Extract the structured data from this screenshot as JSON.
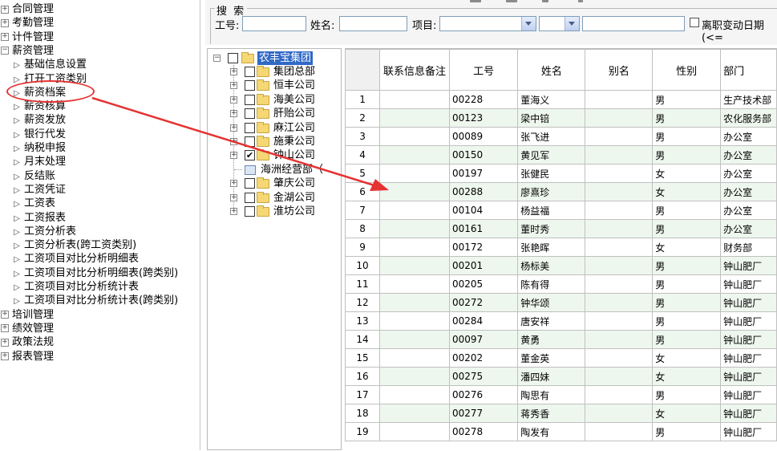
{
  "left_nav": {
    "items": [
      {
        "label": "合同管理",
        "icon": "plus-icon"
      },
      {
        "label": "考勤管理",
        "icon": "plus-icon"
      },
      {
        "label": "计件管理",
        "icon": "plus-icon"
      },
      {
        "label": "薪资管理",
        "icon": "minus-icon"
      },
      {
        "label": "基础信息设置",
        "icon": "expand-arrow-icon"
      },
      {
        "label": "打开工资类别",
        "icon": "triangle-right-icon"
      },
      {
        "label": "薪资档案",
        "icon": "triangle-right-icon"
      },
      {
        "label": "薪资核算",
        "icon": "expand-arrow-icon"
      },
      {
        "label": "薪资发放",
        "icon": "expand-arrow-icon"
      },
      {
        "label": "银行代发",
        "icon": "triangle-right-icon"
      },
      {
        "label": "纳税申报",
        "icon": "expand-arrow-icon"
      },
      {
        "label": "月末处理",
        "icon": "triangle-right-icon"
      },
      {
        "label": "反结账",
        "icon": "triangle-right-icon"
      },
      {
        "label": "工资凭证",
        "icon": "expand-arrow-icon"
      },
      {
        "label": "工资表",
        "icon": "triangle-right-icon"
      },
      {
        "label": "工资报表",
        "icon": "triangle-right-icon"
      },
      {
        "label": "工资分析表",
        "icon": "triangle-right-icon"
      },
      {
        "label": "工资分析表(跨工资类别)",
        "icon": "triangle-right-icon"
      },
      {
        "label": "工资项目对比分析明细表",
        "icon": "triangle-right-icon"
      },
      {
        "label": "工资项目对比分析明细表(跨类别)",
        "icon": "triangle-right-icon"
      },
      {
        "label": "工资项目对比分析统计表",
        "icon": "triangle-right-icon"
      },
      {
        "label": "工资项目对比分析统计表(跨类别)",
        "icon": "triangle-right-icon"
      },
      {
        "label": "培训管理",
        "icon": "plus-icon"
      },
      {
        "label": "绩效管理",
        "icon": "plus-icon"
      },
      {
        "label": "政策法规",
        "icon": "plus-icon"
      },
      {
        "label": "报表管理",
        "icon": "plus-icon"
      }
    ]
  },
  "search": {
    "title": "搜 索",
    "id_label": "工号:",
    "name_label": "姓名:",
    "item_label": "项目:",
    "resign_label": "离职变动日期(<=",
    "id_value": "",
    "name_value": "",
    "item_value": "",
    "op_value": "",
    "keyword_value": ""
  },
  "tree": {
    "root": "农丰宝集团",
    "nodes": [
      {
        "label": "集团总部",
        "checked": false,
        "type": "folder"
      },
      {
        "label": "恒丰公司",
        "checked": false,
        "type": "folder"
      },
      {
        "label": "海美公司",
        "checked": false,
        "type": "folder"
      },
      {
        "label": "肝贻公司",
        "checked": false,
        "type": "folder"
      },
      {
        "label": "麻江公司",
        "checked": false,
        "type": "folder"
      },
      {
        "label": "施秉公司",
        "checked": false,
        "type": "folder"
      },
      {
        "label": "钟山公司",
        "checked": true,
        "type": "folder"
      },
      {
        "label": "海洲经营部（",
        "checked": false,
        "type": "doc"
      },
      {
        "label": "肇庆公司",
        "checked": false,
        "type": "folder"
      },
      {
        "label": "金湖公司",
        "checked": false,
        "type": "folder"
      },
      {
        "label": "淮坊公司",
        "checked": false,
        "type": "folder"
      }
    ]
  },
  "grid": {
    "columns": [
      "",
      "联系信息备注",
      "工号",
      "姓名",
      "别名",
      "性别",
      "部门"
    ],
    "rows": [
      {
        "n": "1",
        "note": "",
        "id": "00228",
        "name": "董海义",
        "alias": "",
        "sex": "男",
        "dept": "生产技术部"
      },
      {
        "n": "2",
        "note": "",
        "id": "00123",
        "name": "梁中锫",
        "alias": "",
        "sex": "男",
        "dept": "农化服务部"
      },
      {
        "n": "3",
        "note": "",
        "id": "00089",
        "name": "张飞进",
        "alias": "",
        "sex": "男",
        "dept": "办公室"
      },
      {
        "n": "4",
        "note": "",
        "id": "00150",
        "name": "黄见军",
        "alias": "",
        "sex": "男",
        "dept": "办公室"
      },
      {
        "n": "5",
        "note": "",
        "id": "00197",
        "name": "张健民",
        "alias": "",
        "sex": "女",
        "dept": "办公室"
      },
      {
        "n": "6",
        "note": "",
        "id": "00288",
        "name": "廖熹珍",
        "alias": "",
        "sex": "女",
        "dept": "办公室"
      },
      {
        "n": "7",
        "note": "",
        "id": "00104",
        "name": "杨益福",
        "alias": "",
        "sex": "男",
        "dept": "办公室"
      },
      {
        "n": "8",
        "note": "",
        "id": "00161",
        "name": "董时秀",
        "alias": "",
        "sex": "男",
        "dept": "办公室"
      },
      {
        "n": "9",
        "note": "",
        "id": "00172",
        "name": "张艳晖",
        "alias": "",
        "sex": "女",
        "dept": "财务部"
      },
      {
        "n": "10",
        "note": "",
        "id": "00201",
        "name": "杨标美",
        "alias": "",
        "sex": "男",
        "dept": "钟山肥厂"
      },
      {
        "n": "11",
        "note": "",
        "id": "00205",
        "name": "陈有得",
        "alias": "",
        "sex": "男",
        "dept": "钟山肥厂"
      },
      {
        "n": "12",
        "note": "",
        "id": "00272",
        "name": "钟华颂",
        "alias": "",
        "sex": "男",
        "dept": "钟山肥厂"
      },
      {
        "n": "13",
        "note": "",
        "id": "00284",
        "name": "唐安祥",
        "alias": "",
        "sex": "男",
        "dept": "钟山肥厂"
      },
      {
        "n": "14",
        "note": "",
        "id": "00097",
        "name": "黄勇",
        "alias": "",
        "sex": "男",
        "dept": "钟山肥厂"
      },
      {
        "n": "15",
        "note": "",
        "id": "00202",
        "name": "董金英",
        "alias": "",
        "sex": "女",
        "dept": "钟山肥厂"
      },
      {
        "n": "16",
        "note": "",
        "id": "00275",
        "name": "潘四妹",
        "alias": "",
        "sex": "女",
        "dept": "钟山肥厂"
      },
      {
        "n": "17",
        "note": "",
        "id": "00276",
        "name": "陶思有",
        "alias": "",
        "sex": "男",
        "dept": "钟山肥厂"
      },
      {
        "n": "18",
        "note": "",
        "id": "00277",
        "name": "蒋秀香",
        "alias": "",
        "sex": "女",
        "dept": "钟山肥厂"
      },
      {
        "n": "19",
        "note": "",
        "id": "00278",
        "name": "陶发有",
        "alias": "",
        "sex": "男",
        "dept": "钟山肥厂"
      }
    ]
  },
  "annotation": {
    "color": "#e53333"
  }
}
